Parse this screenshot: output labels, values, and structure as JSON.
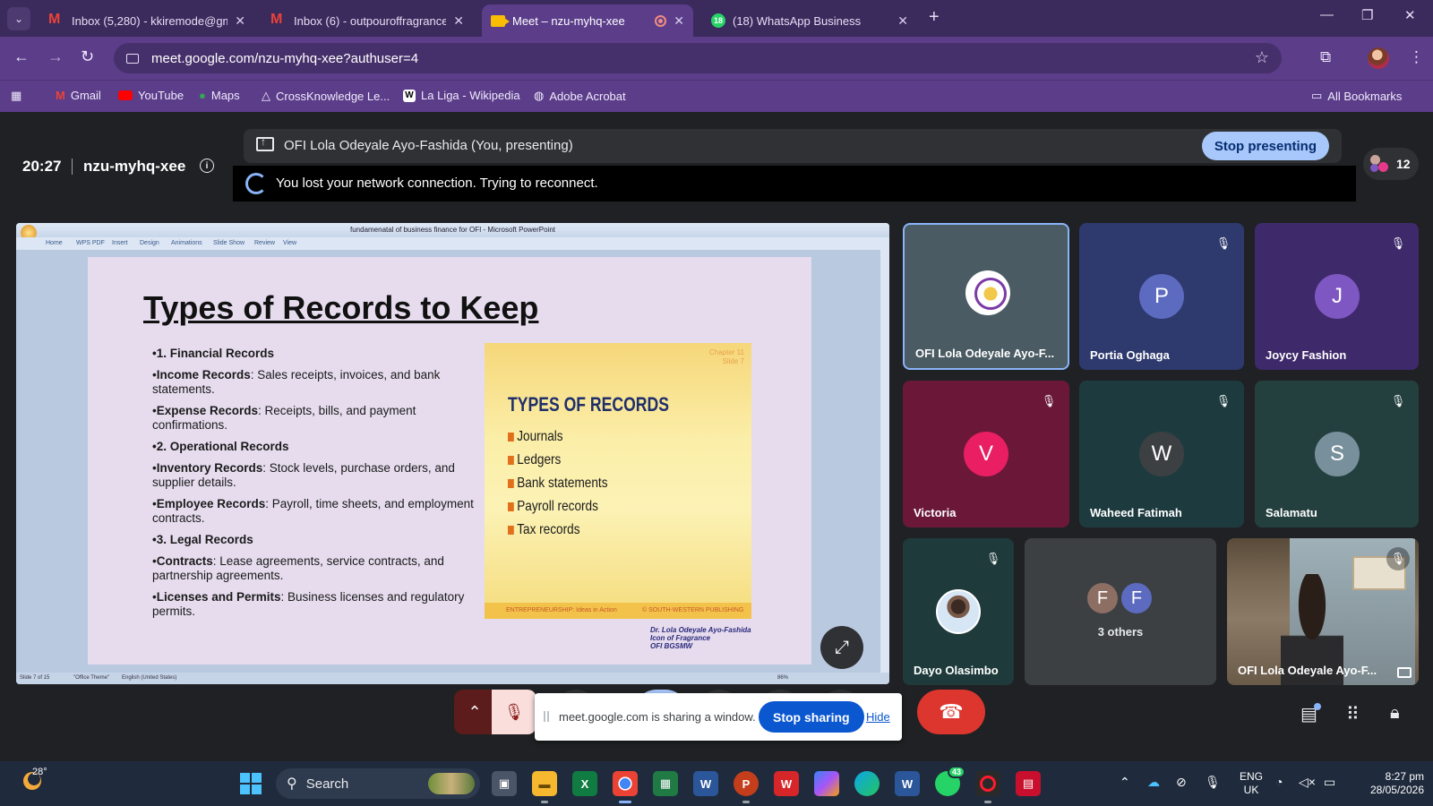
{
  "browser": {
    "tabs": [
      {
        "title": "Inbox (5,280) - kkiremode@gm",
        "icon": "gmail-icon"
      },
      {
        "title": "Inbox (6) - outpouroffragrance",
        "icon": "gmail-icon"
      },
      {
        "title": "Meet – nzu-myhq-xee",
        "icon": "meet-icon",
        "active": true
      },
      {
        "title": "(18) WhatsApp Business",
        "icon": "whatsapp-icon",
        "badge": "18"
      }
    ],
    "url": "meet.google.com/nzu-myhq-xee?authuser=4",
    "bookmarks": [
      "Gmail",
      "YouTube",
      "Maps",
      "CrossKnowledge Le...",
      "La Liga - Wikipedia",
      "Adobe Acrobat"
    ],
    "all_bookmarks": "All Bookmarks"
  },
  "meet": {
    "time": "20:27",
    "code": "nzu-myhq-xee",
    "presenting_text": "OFI Lola Odeyale Ayo-Fashida (You, presenting)",
    "stop_presenting": "Stop presenting",
    "connection_msg": "You lost your network connection. Trying to reconnect.",
    "people_count": "12",
    "participants": [
      {
        "name": "OFI Lola Odeyale Ayo-F...",
        "avatar": "logo"
      },
      {
        "name": "Portia Oghaga",
        "initial": "P",
        "color": "#5c6bc0",
        "muted": true
      },
      {
        "name": "Joycy Fashion",
        "initial": "J",
        "color": "#7e57c2",
        "muted": true
      },
      {
        "name": "Victoria",
        "initial": "V",
        "color": "#e91e63",
        "muted": true
      },
      {
        "name": "Waheed Fatimah",
        "initial": "W",
        "color": "#3c4043",
        "muted": true
      },
      {
        "name": "Salamatu",
        "initial": "S",
        "color": "#78909c",
        "muted": true
      },
      {
        "name": "Dayo Olasimbo",
        "avatar": "photo",
        "muted": true
      },
      {
        "name": "OFI Lola Odeyale Ayo-F...",
        "avatar": "webcam",
        "muted": true
      }
    ],
    "others": {
      "label": "3 others",
      "initials": [
        "F",
        "F"
      ]
    },
    "share_popup": {
      "message": "meet.google.com is sharing a window.",
      "stop_sharing": "Stop sharing",
      "hide": "Hide"
    }
  },
  "powerpoint": {
    "window_title": "fundamenatal of business finance for OFI - Microsoft PowerPoint",
    "ribbon": [
      "Home",
      "WPS PDF",
      "Insert",
      "Design",
      "Animations",
      "Slide Show",
      "Review",
      "View"
    ],
    "status": [
      "Slide 7 of 15",
      "\"Office Theme\"",
      "English (United States)",
      "86%"
    ],
    "slide": {
      "title": "Types of Records to Keep",
      "bullets": [
        {
          "head": "1. Financial Records"
        },
        {
          "bold": "Income Records",
          "text": ": Sales receipts, invoices, and bank statements."
        },
        {
          "bold": "Expense Records",
          "text": ": Receipts, bills, and payment confirmations."
        },
        {
          "head": "2. Operational Records"
        },
        {
          "bold": "Inventory Records",
          "text": ": Stock levels, purchase orders, and supplier details."
        },
        {
          "bold": "Employee Records",
          "text": ": Payroll, time sheets, and employment contracts."
        },
        {
          "head": "3. Legal Records"
        },
        {
          "bold": "Contracts",
          "text": ": Lease agreements, service contracts, and partnership agreements."
        },
        {
          "bold": "Licenses and Permits",
          "text": ": Business licenses and regulatory permits."
        }
      ],
      "image": {
        "corner": [
          "Chapter 11",
          "Slide 7"
        ],
        "title": "TYPES OF RECORDS",
        "items": [
          "Journals",
          "Ledgers",
          "Bank statements",
          "Payroll records",
          "Tax records"
        ],
        "footer_left": "ENTREPRENEURSHIP: Ideas in Action",
        "footer_right": "© SOUTH-WESTERN PUBLISHING"
      },
      "author": [
        "Dr. Lola Odeyale Ayo-Fashida",
        "Icon of Fragrance",
        "OFI BGSMW"
      ]
    }
  },
  "taskbar": {
    "temperature": "28°",
    "search": "Search",
    "whatsapp_badge": "43",
    "lang": [
      "ENG",
      "UK"
    ],
    "time": "8:27 pm",
    "date": "28/05/2026"
  }
}
